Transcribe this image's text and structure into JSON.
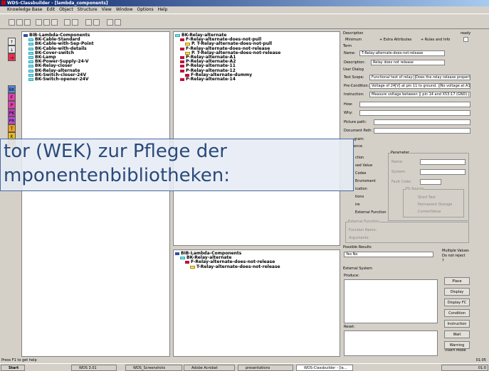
{
  "window": {
    "title": "WDS-Classbuilder - [lambda_components]"
  },
  "menu": [
    "Knowledge Base",
    "Edit",
    "Object",
    "Structure",
    "View",
    "Window",
    "Options",
    "Help"
  ],
  "left_buttons": [
    "↑",
    "↓",
    "→",
    "BK",
    "F",
    "P",
    "PK",
    "PR",
    "T",
    "K",
    "FT"
  ],
  "tree1": [
    {
      "label": "BIB-Lambda-Components",
      "icon": "bookb",
      "indent": 0
    },
    {
      "label": "BK-Cable-Standard",
      "icon": "fold",
      "indent": 1
    },
    {
      "label": "BK-Cable-with-Sep-Point",
      "icon": "fold",
      "indent": 1
    },
    {
      "label": "BK-Cable-with-details",
      "icon": "fold",
      "indent": 1
    },
    {
      "label": "BK-Cover-switch",
      "icon": "fold",
      "indent": 1
    },
    {
      "label": "BK-Lamp",
      "icon": "fold",
      "indent": 1
    },
    {
      "label": "BK-Power-Supply-24-V",
      "icon": "fold",
      "indent": 1
    },
    {
      "label": "BK-Relay-closer",
      "icon": "fold",
      "indent": 1
    },
    {
      "label": "BK-Relay-alternate",
      "icon": "fold",
      "indent": 1
    },
    {
      "label": "BK-Switch-closer-24V",
      "icon": "fold",
      "indent": 1
    },
    {
      "label": "BK-Switch-opener-24V",
      "icon": "fold",
      "indent": 1
    }
  ],
  "tree2": [
    {
      "label": "BK-Relay-alternate",
      "icon": "fold",
      "indent": 0
    },
    {
      "label": "F-Relay-alternate-does-not-pull",
      "icon": "book",
      "indent": 1
    },
    {
      "label": "P. T-Relay-alternate-does-not-pull",
      "icon": "fold y",
      "indent": 2
    },
    {
      "label": "F-Relay-alternate-does-not-release",
      "icon": "book",
      "indent": 1
    },
    {
      "label": "P. T-Relay-alternate-does-not-release",
      "icon": "fold y",
      "indent": 2
    },
    {
      "label": "P-Relay-alternate-A1",
      "icon": "book",
      "indent": 1
    },
    {
      "label": "P-Relay-alternate-A2",
      "icon": "book",
      "indent": 1
    },
    {
      "label": "P-Relay-alternate-11",
      "icon": "book",
      "indent": 1
    },
    {
      "label": "P-Relay-alternate-12",
      "icon": "book",
      "indent": 1
    },
    {
      "label": "F-Relay-alternate-dummy",
      "icon": "book",
      "indent": 2
    },
    {
      "label": "P-Relay-alternate-14",
      "icon": "book",
      "indent": 1
    }
  ],
  "tree3": [
    {
      "label": "BIB-Lambda-Components",
      "icon": "bookb",
      "indent": 0
    },
    {
      "label": "BK-Relay-alternate",
      "icon": "fold",
      "indent": 1
    },
    {
      "label": "F-Relay-alternate-does-not-release",
      "icon": "book",
      "indent": 2
    },
    {
      "label": "T-Relay-alternate-does-not-release",
      "icon": "fold y",
      "indent": 3
    }
  ],
  "right": {
    "description_label": "Description",
    "ready_label": "ready",
    "opt_min": "Minimum",
    "opt_extra": "+ Extra Attributes",
    "opt_rules": "+ Rules and Info",
    "term_label": "Term",
    "name_label": "Name:",
    "name_value": "T-Relay-alternate-does-not-release",
    "desc_label": "Description:",
    "desc_value": "Relay does not release",
    "user_dialog": "User Dialog",
    "scope_label": "Test Scope:",
    "scope_value": "Functional test of relay:||Does the relay release properly?",
    "pre_label": "Pre-Condition:",
    "pre_value": "Voltage of 24[V] at pin 11 to ground. ||No voltage at A1||AZ",
    "instr_label": "Instruction:",
    "instr_value": "Measure voltage between || pin 14 and X53:17 (GND).||||",
    "how_label": "How:",
    "why_label": "Why:",
    "pic_label": "Picture path:",
    "doc_label": "Document Path:",
    "gram_label": "gram:",
    "ence_label": "ence",
    "param_label": "Parameter",
    "pname": "Name:",
    "psystem": "System:",
    "pfault": "Fault Code:",
    "ps_source": "PS-Source",
    "ps_opts": [
      "Short Test",
      "Permanent Storage",
      "CurrentValue"
    ],
    "side_items": [
      "ction",
      "sed Value",
      "Codes",
      "Enviroment",
      "ication",
      "tions",
      "ire",
      "External Function"
    ],
    "ext_func": "External Function",
    "func_name": "Function Name:",
    "args": "Arguments:",
    "possible": "Possible Results",
    "possible_value": "Yes No",
    "chk_multi": "Multiple Values",
    "chk_noreject": "Do not reject",
    "chk_q": "?",
    "ext_system": "External System",
    "produce": "Produce:",
    "reset": "Reset:",
    "buttons": [
      "Place",
      "Display",
      "Display FC",
      "Condition",
      "Instruction",
      "Wait",
      "Warning"
    ],
    "insert_mode": "Insert Mode"
  },
  "overlay": {
    "line1": "tor (WEK) zur Pflege der",
    "line2": "mponentenbibliotheken:"
  },
  "status": {
    "left": "Press F1 to get help",
    "time": "01:05"
  },
  "taskbar": {
    "start": "Start",
    "tasks": [
      "WDS 3.01",
      "WDS_Screenshots",
      "Adobe Acrobat",
      "presentations",
      "WDS-Classbuilder - [la..."
    ],
    "clock": "01:0"
  }
}
